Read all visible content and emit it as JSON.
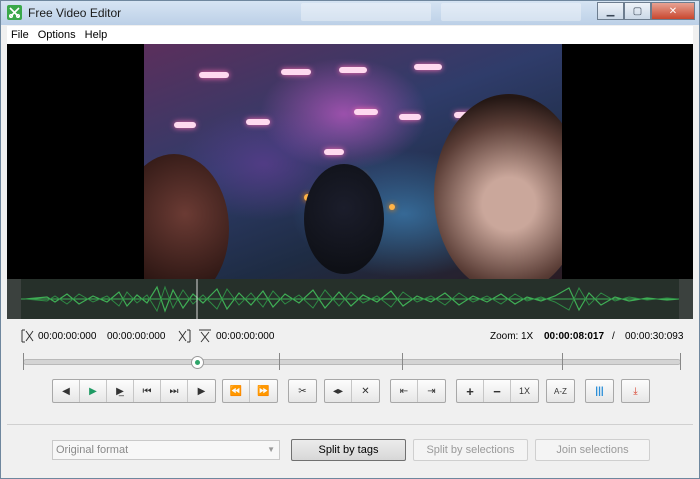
{
  "window": {
    "title": "Free Video Editor"
  },
  "menu": [
    "File",
    "Options",
    "Help"
  ],
  "timeline": {
    "start_time": "00:00:00:000",
    "end_time": "00:00:00:000",
    "cut_time": "00:00:00:000",
    "zoom_label": "Zoom:",
    "zoom_value": "1X",
    "current_time": "00:00:08:017",
    "separator": "/",
    "total_time": "00:00:30:093",
    "playhead_fraction": 0.266
  },
  "toolbar": {
    "zoom_reset": "1X",
    "sort": "A-Z"
  },
  "bottom": {
    "format_placeholder": "Original format",
    "split_tags": "Split by tags",
    "split_selections": "Split by selections",
    "join_selections": "Join selections"
  },
  "colors": {
    "accent_green": "#1e9a63",
    "accent_blue": "#2b8fd8",
    "accent_red": "#d8402c",
    "waveform": "#3fae55"
  }
}
